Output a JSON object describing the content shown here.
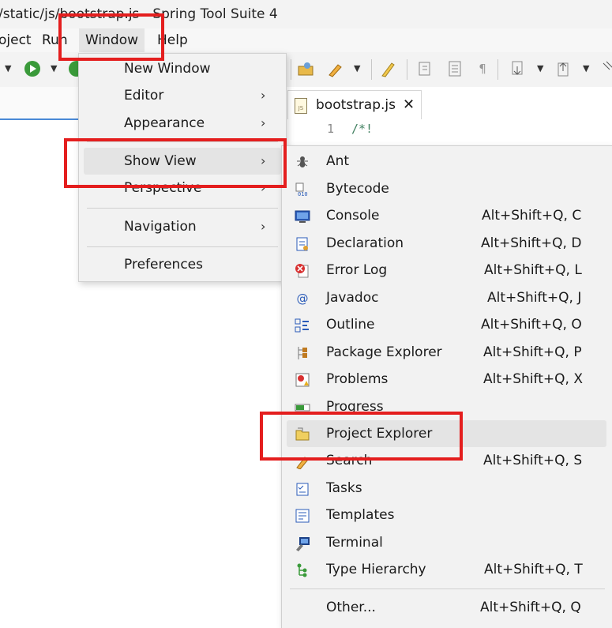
{
  "window_title": "/static/js/bootstrap.js - Spring Tool Suite 4",
  "menubar": {
    "items": [
      "oject",
      "Run",
      "Window",
      "Help"
    ]
  },
  "editor": {
    "tab_label": "bootstrap.js",
    "file_icon_text": "JS",
    "line_numbers": [
      "1"
    ],
    "lines": [
      "/*!"
    ]
  },
  "window_menu": {
    "items": [
      {
        "label": "New Window",
        "submenu": false
      },
      {
        "label": "Editor",
        "submenu": true
      },
      {
        "label": "Appearance",
        "submenu": true
      },
      {
        "label": "Show View",
        "submenu": true,
        "highlighted": true
      },
      {
        "label": "Perspective",
        "submenu": true
      },
      {
        "label": "Navigation",
        "submenu": true
      },
      {
        "label": "Preferences",
        "submenu": false
      }
    ],
    "arrow": "›"
  },
  "show_view_menu": {
    "items": [
      {
        "label": "Ant",
        "shortcut": "",
        "icon": "ant-icon"
      },
      {
        "label": "Bytecode",
        "shortcut": "",
        "icon": "bytecode-icon"
      },
      {
        "label": "Console",
        "shortcut": "Alt+Shift+Q, C",
        "icon": "console-icon"
      },
      {
        "label": "Declaration",
        "shortcut": "Alt+Shift+Q, D",
        "icon": "declaration-icon"
      },
      {
        "label": "Error Log",
        "shortcut": "Alt+Shift+Q, L",
        "icon": "error-log-icon"
      },
      {
        "label": "Javadoc",
        "shortcut": "Alt+Shift+Q, J",
        "icon": "javadoc-icon"
      },
      {
        "label": "Outline",
        "shortcut": "Alt+Shift+Q, O",
        "icon": "outline-icon"
      },
      {
        "label": "Package Explorer",
        "shortcut": "Alt+Shift+Q, P",
        "icon": "package-explorer-icon"
      },
      {
        "label": "Problems",
        "shortcut": "Alt+Shift+Q, X",
        "icon": "problems-icon"
      },
      {
        "label": "Progress",
        "shortcut": "",
        "icon": "progress-icon"
      },
      {
        "label": "Project Explorer",
        "shortcut": "",
        "icon": "project-explorer-icon",
        "highlighted": true
      },
      {
        "label": "Search",
        "shortcut": "Alt+Shift+Q, S",
        "icon": "search-icon"
      },
      {
        "label": "Tasks",
        "shortcut": "",
        "icon": "tasks-icon"
      },
      {
        "label": "Templates",
        "shortcut": "",
        "icon": "templates-icon"
      },
      {
        "label": "Terminal",
        "shortcut": "",
        "icon": "terminal-icon"
      },
      {
        "label": "Type Hierarchy",
        "shortcut": "Alt+Shift+Q, T",
        "icon": "type-hierarchy-icon"
      },
      {
        "label": "Other...",
        "shortcut": "Alt+Shift+Q, Q",
        "icon": ""
      }
    ]
  },
  "colors": {
    "annotation": "#e41e1e",
    "menu_bg": "#f2f2f2",
    "highlight": "#e4e4e4"
  }
}
